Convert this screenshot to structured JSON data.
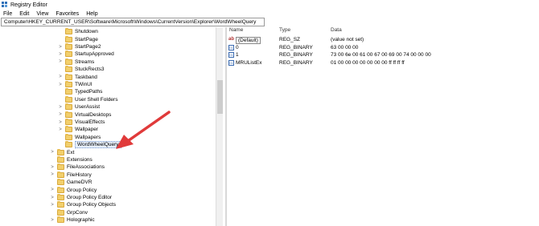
{
  "window": {
    "title": "Registry Editor"
  },
  "menu": [
    "File",
    "Edit",
    "View",
    "Favorites",
    "Help"
  ],
  "address": "Computer\\HKEY_CURRENT_USER\\Software\\Microsoft\\Windows\\CurrentVersion\\Explorer\\WordWheelQuery",
  "tree": {
    "items": [
      {
        "label": "Shutdown",
        "expander": "",
        "indent": 1
      },
      {
        "label": "StartPage",
        "expander": "",
        "indent": 1
      },
      {
        "label": "StartPage2",
        "expander": ">",
        "indent": 1
      },
      {
        "label": "StartupApproved",
        "expander": ">",
        "indent": 1
      },
      {
        "label": "Streams",
        "expander": ">",
        "indent": 1
      },
      {
        "label": "StuckRects3",
        "expander": "",
        "indent": 1
      },
      {
        "label": "Taskband",
        "expander": ">",
        "indent": 1
      },
      {
        "label": "TWinUI",
        "expander": ">",
        "indent": 1
      },
      {
        "label": "TypedPaths",
        "expander": "",
        "indent": 1
      },
      {
        "label": "User Shell Folders",
        "expander": "",
        "indent": 1
      },
      {
        "label": "UserAssist",
        "expander": ">",
        "indent": 1
      },
      {
        "label": "VirtualDesktops",
        "expander": ">",
        "indent": 1
      },
      {
        "label": "VisualEffects",
        "expander": ">",
        "indent": 1
      },
      {
        "label": "Wallpaper",
        "expander": ">",
        "indent": 1
      },
      {
        "label": "Wallpapers",
        "expander": "",
        "indent": 1
      },
      {
        "label": "WordWheelQuery",
        "expander": "",
        "indent": 1,
        "selected": true
      },
      {
        "label": "Ext",
        "expander": ">",
        "indent": 0
      },
      {
        "label": "Extensions",
        "expander": "",
        "indent": 0
      },
      {
        "label": "FileAssociations",
        "expander": ">",
        "indent": 0
      },
      {
        "label": "FileHistory",
        "expander": ">",
        "indent": 0
      },
      {
        "label": "GameDVR",
        "expander": "",
        "indent": 0
      },
      {
        "label": "Group Policy",
        "expander": ">",
        "indent": 0
      },
      {
        "label": "Group Policy Editor",
        "expander": ">",
        "indent": 0
      },
      {
        "label": "Group Policy Objects",
        "expander": ">",
        "indent": 0
      },
      {
        "label": "GrpConv",
        "expander": "",
        "indent": 0
      },
      {
        "label": "Holographic",
        "expander": ">",
        "indent": 0
      }
    ]
  },
  "values": {
    "headers": {
      "name": "Name",
      "type": "Type",
      "data": "Data"
    },
    "rows": [
      {
        "icon": "string-value-icon",
        "icon_glyph": "ab",
        "name": "(Default)",
        "type": "REG_SZ",
        "data": "(value not set)"
      },
      {
        "icon": "binary-value-icon",
        "icon_glyph": "01",
        "name": "0",
        "type": "REG_BINARY",
        "data": "63 00 00 00"
      },
      {
        "icon": "binary-value-icon",
        "icon_glyph": "01",
        "name": "1",
        "type": "REG_BINARY",
        "data": "73 00 6e 00 61 00 67 00 69 00 74 00 00 00"
      },
      {
        "icon": "binary-value-icon",
        "icon_glyph": "01",
        "name": "MRUListEx",
        "type": "REG_BINARY",
        "data": "01 00 00 00 00 00 00 00 ff ff ff ff"
      }
    ]
  },
  "colors": {
    "folder": "#f2cf6c",
    "arrow": "#e03a3a",
    "selection": "#e6eef9"
  }
}
